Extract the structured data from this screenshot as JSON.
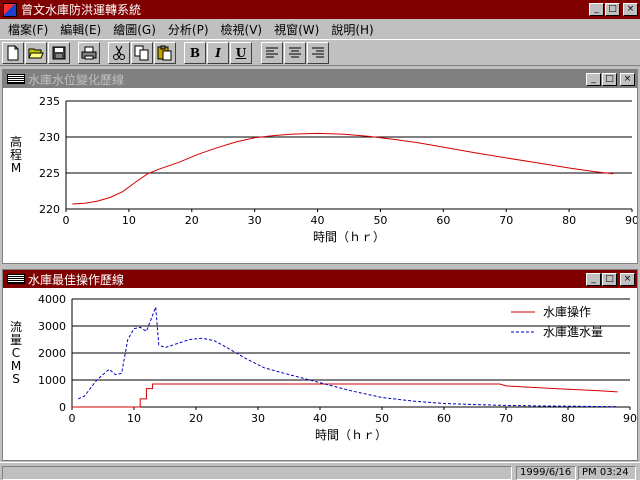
{
  "window": {
    "title": "曾文水庫防洪運轉系統",
    "buttons": {
      "minimize": "_",
      "maximize": "□",
      "close": "×"
    }
  },
  "menu": [
    "檔案(F)",
    "編輯(E)",
    "繪圖(G)",
    "分析(P)",
    "檢視(V)",
    "視窗(W)",
    "說明(H)"
  ],
  "toolbar": {
    "bold": "B",
    "italic": "I",
    "underline": "U",
    "icons": [
      "new-file-icon",
      "open-folder-icon",
      "save-disk-icon",
      "print-icon",
      "cut-scissors-icon",
      "copy-icon",
      "paste-icon",
      "bold-icon",
      "italic-icon",
      "underline-icon",
      "align-left-icon",
      "align-center-icon",
      "align-right-icon"
    ]
  },
  "panel1": {
    "title": "水庫水位變化歷線",
    "ylabel": "高程M",
    "xlabel": "時間（ｈｒ）"
  },
  "panel2": {
    "title": "水庫最佳操作歷線",
    "ylabel": "流量CMS",
    "xlabel": "時間（ｈｒ）",
    "legend": [
      "水庫操作",
      "水庫進水量"
    ]
  },
  "status": {
    "date": "1999/6/16",
    "time": "PM 03:24"
  },
  "chart_data": [
    {
      "type": "line",
      "title": "水庫水位變化歷線",
      "xlabel": "時間（ｈｒ）",
      "ylabel": "高程M",
      "xlim": [
        0,
        90
      ],
      "ylim": [
        220,
        235
      ],
      "xticks": [
        0,
        10,
        20,
        30,
        40,
        50,
        60,
        70,
        80,
        90
      ],
      "yticks": [
        220,
        225,
        230,
        235
      ],
      "grid": "horizontal",
      "color": "#d40000",
      "series": [
        {
          "x": [
            1,
            3,
            5,
            7,
            9,
            11,
            13,
            15,
            18,
            21,
            24,
            27,
            30,
            33,
            36,
            40,
            44,
            48,
            52,
            56,
            60,
            65,
            70,
            75,
            80,
            84,
            87
          ],
          "y": [
            220.7,
            220.8,
            221.1,
            221.6,
            222.4,
            223.7,
            224.9,
            225.6,
            226.5,
            227.6,
            228.5,
            229.3,
            229.9,
            230.2,
            230.4,
            230.5,
            230.4,
            230.1,
            229.7,
            229.2,
            228.6,
            227.8,
            227.1,
            226.4,
            225.7,
            225.2,
            224.9
          ]
        }
      ]
    },
    {
      "type": "line",
      "title": "水庫最佳操作歷線",
      "xlabel": "時間（ｈｒ）",
      "ylabel": "流量CMS",
      "xlim": [
        0,
        90
      ],
      "ylim": [
        0,
        4000
      ],
      "xticks": [
        0,
        10,
        20,
        30,
        40,
        50,
        60,
        70,
        80,
        90
      ],
      "yticks": [
        0,
        1000,
        2000,
        3000,
        4000
      ],
      "grid": "horizontal",
      "legend_position": "top-right",
      "series": [
        {
          "name": "水庫操作",
          "color": "#d40000",
          "dash": "solid",
          "x": [
            0,
            11,
            11,
            12,
            12,
            13,
            13,
            69,
            70,
            75,
            80,
            85,
            88
          ],
          "y": [
            0,
            0,
            300,
            300,
            680,
            680,
            850,
            850,
            780,
            720,
            660,
            600,
            560
          ]
        },
        {
          "name": "水庫進水量",
          "color": "#0000c0",
          "dash": "dashed",
          "x": [
            1,
            2,
            3,
            4,
            5,
            6,
            7,
            8,
            9,
            10,
            11,
            12,
            13,
            13.5,
            14,
            15,
            17,
            19,
            21,
            23,
            25,
            28,
            31,
            35,
            40,
            45,
            50,
            55,
            60,
            65,
            70,
            75,
            80,
            85,
            88
          ],
          "y": [
            300,
            400,
            700,
            1000,
            1200,
            1400,
            1200,
            1250,
            2500,
            2900,
            2950,
            2800,
            3400,
            3700,
            2300,
            2200,
            2350,
            2500,
            2550,
            2450,
            2200,
            1800,
            1450,
            1200,
            900,
            600,
            350,
            220,
            130,
            90,
            60,
            40,
            30,
            20,
            10
          ]
        }
      ]
    }
  ]
}
